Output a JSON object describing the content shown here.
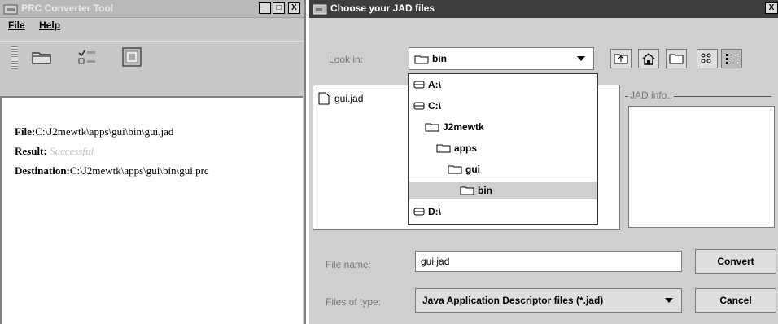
{
  "left_window": {
    "title": "PRC Converter Tool",
    "controls": [
      "_",
      "□",
      "X"
    ],
    "menu": [
      "File",
      "Help"
    ],
    "toolbar_icons": [
      "open-folder-icon",
      "checklist-icon",
      "settings-icon"
    ],
    "results": {
      "file_label": "File:",
      "file_value": "C:\\J2mewtk\\apps\\gui\\bin\\gui.jad",
      "result_label": "Result:",
      "result_value": "Successful",
      "destination_label": "Destination:",
      "destination_value": "C:\\J2mewtk\\apps\\gui\\bin\\gui.prc"
    }
  },
  "dialog": {
    "title": "Choose your JAD files",
    "close": "X",
    "look_in_label": "Look in:",
    "look_in_value": "bin",
    "nav_icons": [
      "up-folder-icon",
      "home-icon",
      "new-folder-icon",
      "list-view-icon",
      "details-view-icon"
    ],
    "files": [
      "gui.jad"
    ],
    "dropdown_items": [
      {
        "label": "A:\\",
        "icon": "drive-icon",
        "indent": 0
      },
      {
        "label": "C:\\",
        "icon": "drive-icon",
        "indent": 0
      },
      {
        "label": "J2mewtk",
        "icon": "folder-icon",
        "indent": 1
      },
      {
        "label": "apps",
        "icon": "folder-icon",
        "indent": 2
      },
      {
        "label": "gui",
        "icon": "folder-icon",
        "indent": 3
      },
      {
        "label": "bin",
        "icon": "folder-icon",
        "indent": 4,
        "selected": true
      },
      {
        "label": "D:\\",
        "icon": "drive-icon",
        "indent": 0
      }
    ],
    "jad_info_label": "JAD info.:",
    "file_name_label": "File name:",
    "file_name_value": "gui.jad",
    "files_of_type_label": "Files of type:",
    "files_of_type_value": "Java Application Descriptor files (*.jad)",
    "convert_button": "Convert",
    "cancel_button": "Cancel"
  }
}
